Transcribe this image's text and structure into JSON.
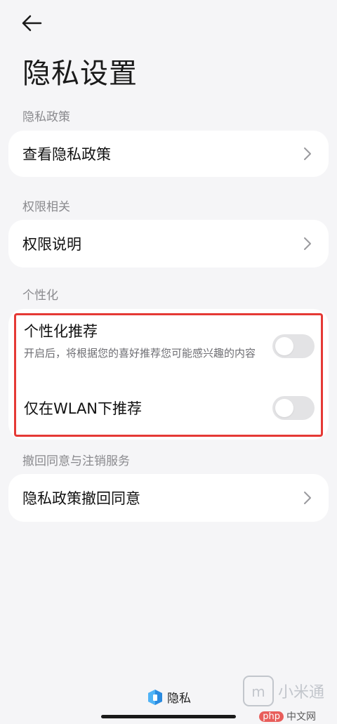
{
  "header": {
    "title": "隐私设置"
  },
  "sections": [
    {
      "label": "隐私政策",
      "item": "查看隐私政策"
    },
    {
      "label": "权限相关",
      "item": "权限说明"
    },
    {
      "label": "个性化"
    },
    {
      "label": "撤回同意与注销服务",
      "item": "隐私政策撤回同意"
    }
  ],
  "personalization": {
    "recommend_title": "个性化推荐",
    "recommend_desc": "开启后，将根据您的喜好推荐您可能感兴趣的内容",
    "recommend_on": false,
    "wlan_title": "仅在WLAN下推荐",
    "wlan_on": false
  },
  "footer": {
    "brand": "隐私"
  },
  "watermarks": {
    "top": "小米通",
    "bottom_php": "php",
    "bottom_site": "中文网"
  },
  "colors": {
    "accent": "#e53935",
    "background": "#f5f5f7",
    "toggle_off": "#e3e3e5"
  }
}
